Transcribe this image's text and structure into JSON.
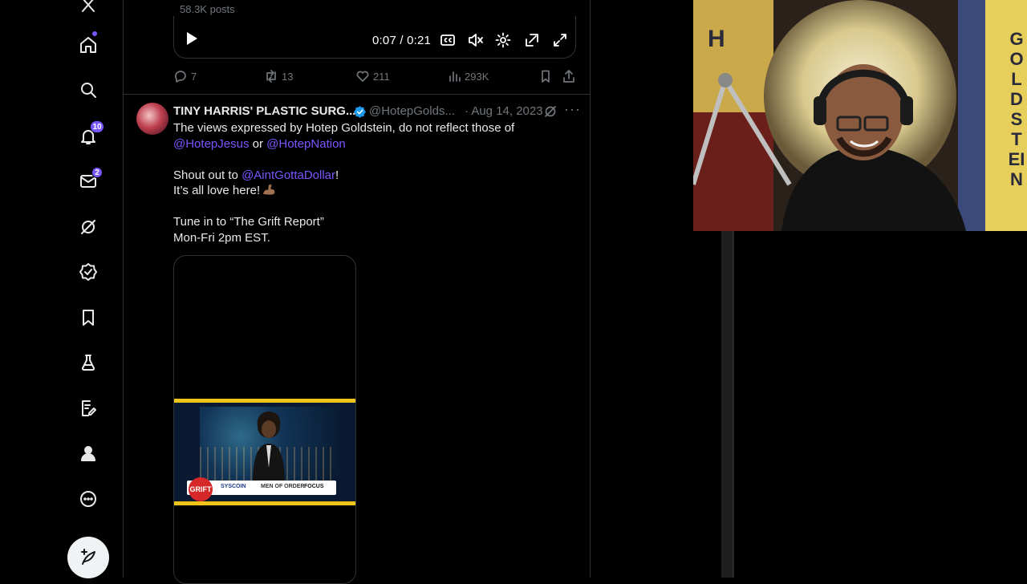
{
  "nav": {
    "notifications_badge": "10",
    "messages_badge": "2",
    "accent_color": "#7856ff"
  },
  "header": {
    "posts_count": "58.3K posts"
  },
  "video_player": {
    "time": "0:07 / 0:21",
    "controls": [
      "play-icon",
      "captions-icon",
      "mute-icon",
      "settings-icon",
      "pip-icon",
      "fullscreen-icon"
    ]
  },
  "prev_tweet_actions": {
    "replies": "7",
    "reposts": "13",
    "likes": "211",
    "views": "293K"
  },
  "tweet": {
    "author": "TINY HARRIS' PLASTIC SURG...",
    "handle": "@HotepGolds...",
    "date": "· Aug 14, 2023",
    "more": "···",
    "text": {
      "l1": "The views expressed by Hotep Goldstein, do not reflect those of",
      "l2_mention_a": "@HotepJesus",
      "l2_or": " or ",
      "l2_mention_b": "@HotepNation",
      "l3_pre": "Shout out to ",
      "l3_mention": "@AintGottaDollar",
      "l3_post": "!",
      "l4": "It’s all love here!",
      "l5": "Tune in to “The Grift Report”",
      "l6": "Mon-Fri 2pm EST."
    },
    "clip": {
      "logo_text": "GRIFT",
      "sponsor_a": "SYSCOIN",
      "sponsor_b": "MEN OF ORDER",
      "sponsor_c": "FOCUS"
    }
  },
  "webcam": {
    "banner_left": "H",
    "banner_right": "GOLDSTEIN"
  }
}
